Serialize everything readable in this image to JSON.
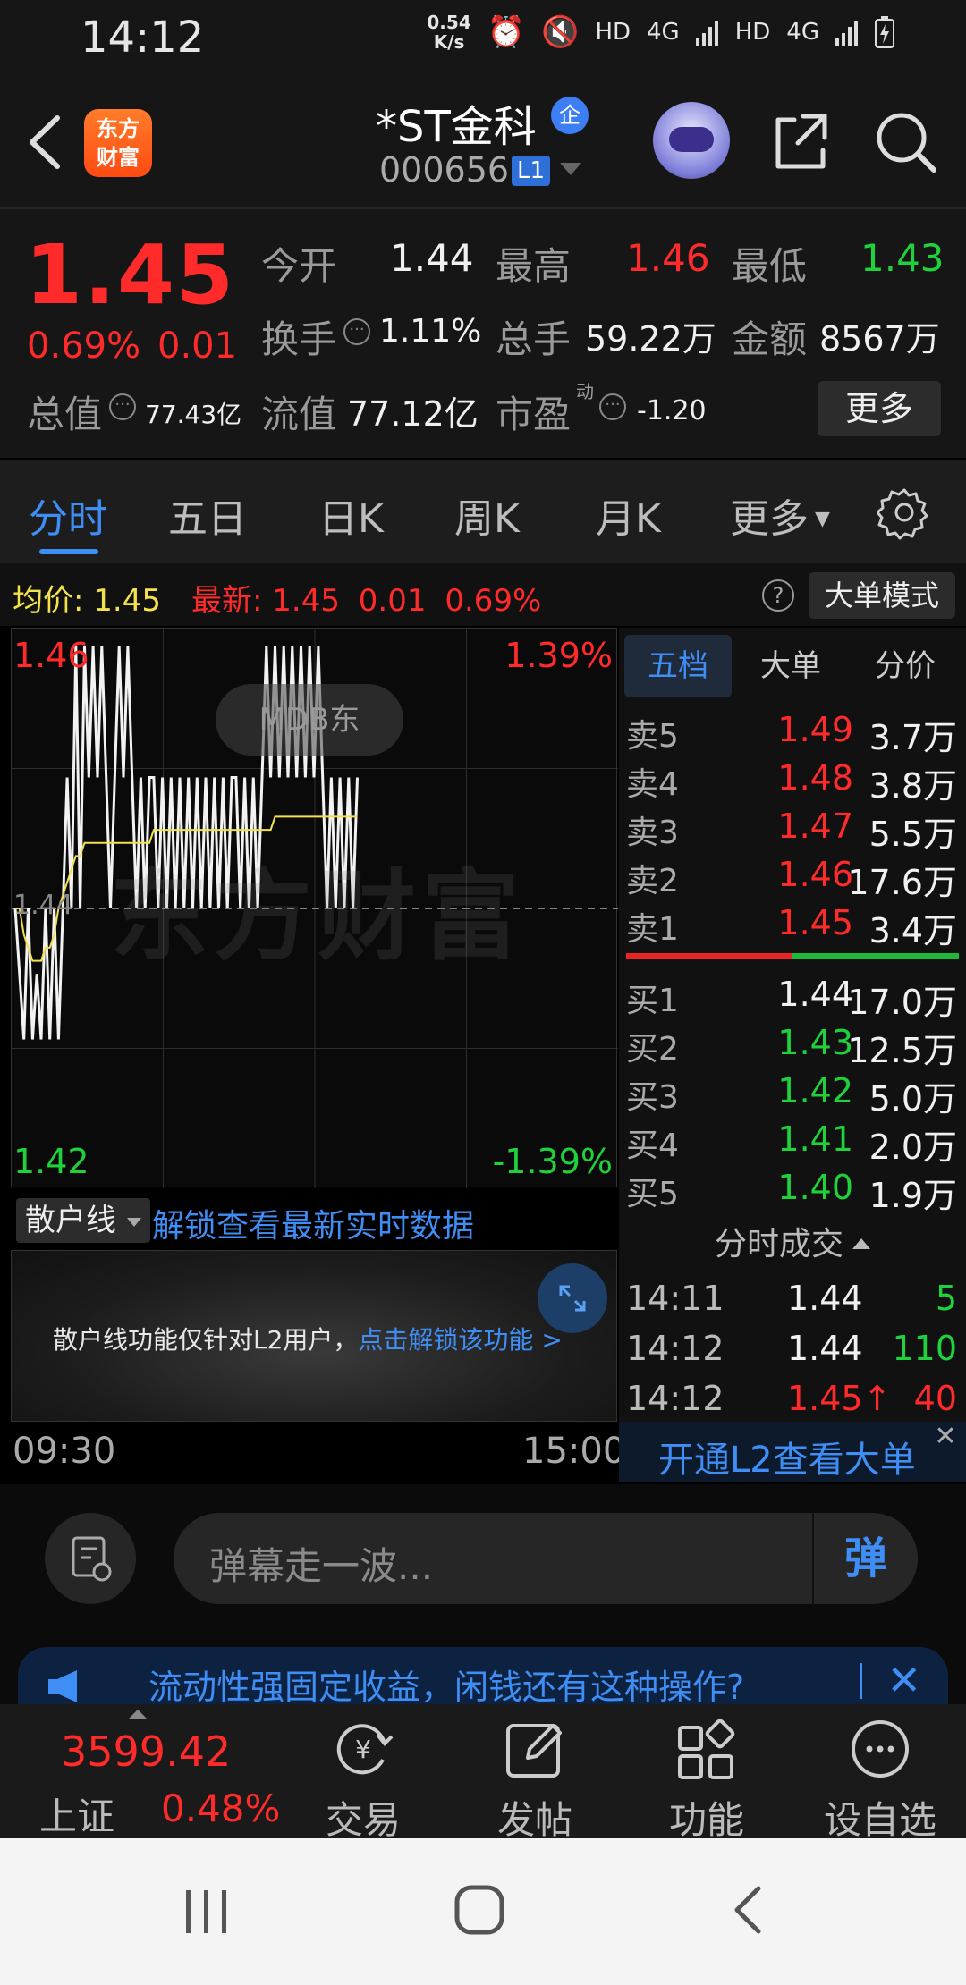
{
  "status_bar": {
    "time": "14:12",
    "net_speed_value": "0.54",
    "net_speed_unit": "K/s",
    "hd1": "HD",
    "sig1": "4G",
    "hd2": "HD",
    "sig2": "4G"
  },
  "header": {
    "logo_text_line1": "东方",
    "logo_text_line2": "财富",
    "stock_name": "*ST金科",
    "ent_badge": "企",
    "stock_code": "000656",
    "level_badge": "L1"
  },
  "quote": {
    "last_price": "1.45",
    "pct_change": "0.69%",
    "abs_change": "0.01",
    "fields": {
      "open_label": "今开",
      "open_value": "1.44",
      "high_label": "最高",
      "high_value": "1.46",
      "low_label": "最低",
      "low_value": "1.43",
      "turnover_label": "换手",
      "turnover_value": "1.11%",
      "volume_label": "总手",
      "volume_value": "59.22万",
      "amount_label": "金额",
      "amount_value": "8567万",
      "mktcap_label": "总值",
      "mktcap_value": "77.43亿",
      "float_label": "流值",
      "float_value": "77.12亿",
      "pe_label": "市盈",
      "pe_sup": "动",
      "pe_value": "-1.20"
    },
    "more_button": "更多"
  },
  "tabs": [
    {
      "label": "分时",
      "active": true
    },
    {
      "label": "五日",
      "active": false
    },
    {
      "label": "日K",
      "active": false
    },
    {
      "label": "周K",
      "active": false
    },
    {
      "label": "月K",
      "active": false
    },
    {
      "label": "更多",
      "active": false
    }
  ],
  "info_row": {
    "avg_label": "均价:",
    "avg_value": "1.45",
    "latest_label": "最新:",
    "latest_price": "1.45",
    "latest_change": "0.01",
    "latest_pct": "0.69%",
    "help": "?",
    "mode_button": "大单模式"
  },
  "chart": {
    "watermark_mdb": "MDB东",
    "watermark_brand": "东方财富",
    "y_top": "1.46",
    "y_mid": "1.44",
    "y_bottom": "1.42",
    "pct_top": "1.39%",
    "pct_bottom": "-1.39%",
    "time_start": "09:30",
    "time_end": "15:00",
    "colors": {
      "price_line": "#f2f2f2",
      "avg_line": "#f3e24b",
      "grid": "#2e2e2e"
    }
  },
  "chart_data": {
    "type": "line",
    "title": "",
    "xlabel": "",
    "ylabel": "",
    "x_range": [
      "09:30",
      "15:00"
    ],
    "ylim": [
      1.42,
      1.46
    ],
    "prev_close": 1.44,
    "series": [
      {
        "values": [
          1.44,
          1.435,
          1.43,
          1.44,
          1.43,
          1.435,
          1.43,
          1.44,
          1.43,
          1.44,
          1.43,
          1.44,
          1.45,
          1.44,
          1.46,
          1.44,
          1.46,
          1.45,
          1.46,
          1.45,
          1.46,
          1.45,
          1.44,
          1.45,
          1.46,
          1.45,
          1.46,
          1.45,
          1.44,
          1.45,
          1.44,
          1.45,
          1.45,
          1.44,
          1.45,
          1.44,
          1.45,
          1.44,
          1.45,
          1.44,
          1.45,
          1.44,
          1.45,
          1.44,
          1.45,
          1.44,
          1.45,
          1.44,
          1.45,
          1.44,
          1.45,
          1.45,
          1.44,
          1.45,
          1.44,
          1.45,
          1.44,
          1.45,
          1.46,
          1.45,
          1.46,
          1.45,
          1.46,
          1.45,
          1.46,
          1.45,
          1.46,
          1.45,
          1.46,
          1.45,
          1.46,
          1.45,
          1.44,
          1.45,
          1.44,
          1.45,
          1.44,
          1.45,
          1.44,
          1.45
        ]
      },
      {
        "values": [
          1.44,
          1.44,
          1.438,
          1.437,
          1.436,
          1.436,
          1.436,
          1.437,
          1.437,
          1.438,
          1.44,
          1.441,
          1.442,
          1.443,
          1.444,
          1.444,
          1.445,
          1.445,
          1.445,
          1.445,
          1.445,
          1.445,
          1.445,
          1.445,
          1.445,
          1.445,
          1.445,
          1.445,
          1.445,
          1.445,
          1.445,
          1.445,
          1.446,
          1.446,
          1.446,
          1.446,
          1.446,
          1.446,
          1.446,
          1.446,
          1.446,
          1.446,
          1.446,
          1.446,
          1.446,
          1.446,
          1.446,
          1.446,
          1.446,
          1.446,
          1.446,
          1.446,
          1.446,
          1.446,
          1.446,
          1.446,
          1.446,
          1.446,
          1.446,
          1.446,
          1.447,
          1.447,
          1.447,
          1.447,
          1.447,
          1.447,
          1.447,
          1.447,
          1.447,
          1.447,
          1.447,
          1.447,
          1.447,
          1.447,
          1.447,
          1.447,
          1.447,
          1.447,
          1.447,
          1.447
        ]
      }
    ]
  },
  "retail": {
    "select_label": "散户线",
    "unlock_link": "解锁查看最新实时数据",
    "note": "散户线功能仅针对L2用户，",
    "note_link": "点击解锁该功能 >"
  },
  "order_book": {
    "tabs": [
      {
        "label": "五档",
        "active": true
      },
      {
        "label": "大单",
        "active": false
      },
      {
        "label": "分价",
        "active": false
      }
    ],
    "asks": [
      {
        "label": "卖5",
        "price": "1.49",
        "volume": "3.7万"
      },
      {
        "label": "卖4",
        "price": "1.48",
        "volume": "3.8万"
      },
      {
        "label": "卖3",
        "price": "1.47",
        "volume": "5.5万"
      },
      {
        "label": "卖2",
        "price": "1.46",
        "volume": "17.6万"
      },
      {
        "label": "卖1",
        "price": "1.45",
        "volume": "3.4万"
      }
    ],
    "bids": [
      {
        "label": "买1",
        "price": "1.44",
        "volume": "17.0万"
      },
      {
        "label": "买2",
        "price": "1.43",
        "volume": "12.5万"
      },
      {
        "label": "买3",
        "price": "1.42",
        "volume": "5.0万"
      },
      {
        "label": "买4",
        "price": "1.41",
        "volume": "2.0万"
      },
      {
        "label": "买5",
        "price": "1.40",
        "volume": "1.9万"
      }
    ],
    "ratio_buy_fraction": 0.5,
    "ticks_header": "分时成交",
    "ticks": [
      {
        "time": "14:11",
        "price": "1.44",
        "volume": "5"
      },
      {
        "time": "14:12",
        "price": "1.44",
        "volume": "110"
      },
      {
        "time": "14:12",
        "price": "1.45↑",
        "volume": "40"
      }
    ],
    "l2_banner": "开通L2查看大单",
    "l2_close": "✕"
  },
  "barrage": {
    "placeholder": "弹幕走一波...",
    "send_label": "弹"
  },
  "promo": {
    "text": "流动性强固定收益，闲钱还有这种操作?",
    "close": "✕"
  },
  "bottom_nav": {
    "index_value": "3599.42",
    "index_name": "上证",
    "index_pct": "0.48%",
    "items": [
      {
        "label": "交易"
      },
      {
        "label": "发帖"
      },
      {
        "label": "功能"
      },
      {
        "label": "设自选"
      }
    ]
  }
}
